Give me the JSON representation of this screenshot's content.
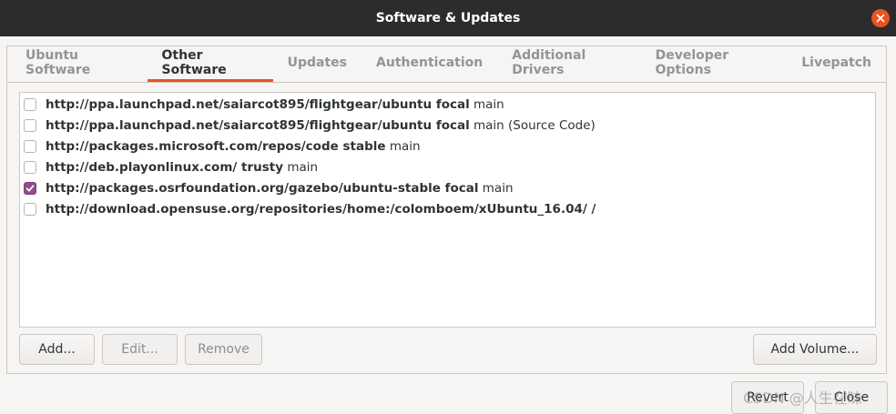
{
  "window": {
    "title": "Software & Updates"
  },
  "tabs": [
    {
      "label": "Ubuntu Software",
      "active": false
    },
    {
      "label": "Other Software",
      "active": true
    },
    {
      "label": "Updates",
      "active": false
    },
    {
      "label": "Authentication",
      "active": false
    },
    {
      "label": "Additional Drivers",
      "active": false
    },
    {
      "label": "Developer Options",
      "active": false
    },
    {
      "label": "Livepatch",
      "active": false
    }
  ],
  "sources": [
    {
      "source": "http://ppa.launchpad.net/saiarcot895/flightgear/ubuntu focal",
      "component": " main",
      "checked": false
    },
    {
      "source": "http://ppa.launchpad.net/saiarcot895/flightgear/ubuntu focal",
      "component": " main (Source Code)",
      "checked": false
    },
    {
      "source": "http://packages.microsoft.com/repos/code stable",
      "component": " main",
      "checked": false
    },
    {
      "source": "http://deb.playonlinux.com/ trusty",
      "component": " main",
      "checked": false
    },
    {
      "source": "http://packages.osrfoundation.org/gazebo/ubuntu-stable focal",
      "component": " main",
      "checked": true
    },
    {
      "source": "http://download.opensuse.org/repositories/home:/colomboem/xUbuntu_16.04/ /",
      "component": "",
      "checked": false
    }
  ],
  "buttons": {
    "add": "Add...",
    "edit": "Edit...",
    "remove": "Remove",
    "add_volume": "Add Volume...",
    "revert": "Revert",
    "close": "Close"
  },
  "watermark": "CSDN @人生在昧",
  "colors": {
    "accent": "#e95420",
    "checkbox": "#924d8b",
    "titlebar": "#2c2c2c"
  }
}
